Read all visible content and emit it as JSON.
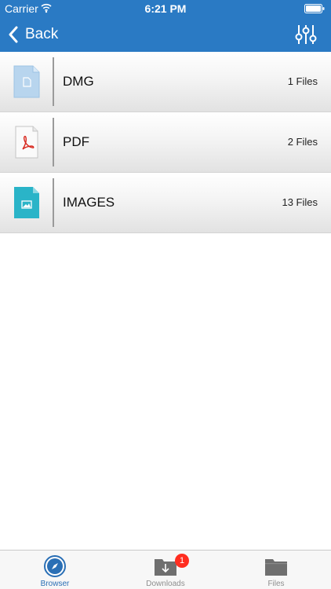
{
  "status_bar": {
    "carrier": "Carrier",
    "time": "6:21 PM"
  },
  "nav": {
    "back_label": "Back",
    "settings_icon": "sliders-icon"
  },
  "colors": {
    "accent": "#2a7ac4",
    "badge": "#ff2d20"
  },
  "file_types": [
    {
      "name": "DMG",
      "count": "1 Files",
      "icon": "generic-file-icon"
    },
    {
      "name": "PDF",
      "count": "2 Files",
      "icon": "pdf-file-icon"
    },
    {
      "name": "IMAGES",
      "count": "13 Files",
      "icon": "image-file-icon"
    }
  ],
  "tabbar": {
    "tabs": [
      {
        "label": "Browser",
        "icon": "compass-icon",
        "active": true
      },
      {
        "label": "Downloads",
        "icon": "download-folder-icon",
        "badge": "1"
      },
      {
        "label": "Files",
        "icon": "folder-icon"
      }
    ]
  }
}
